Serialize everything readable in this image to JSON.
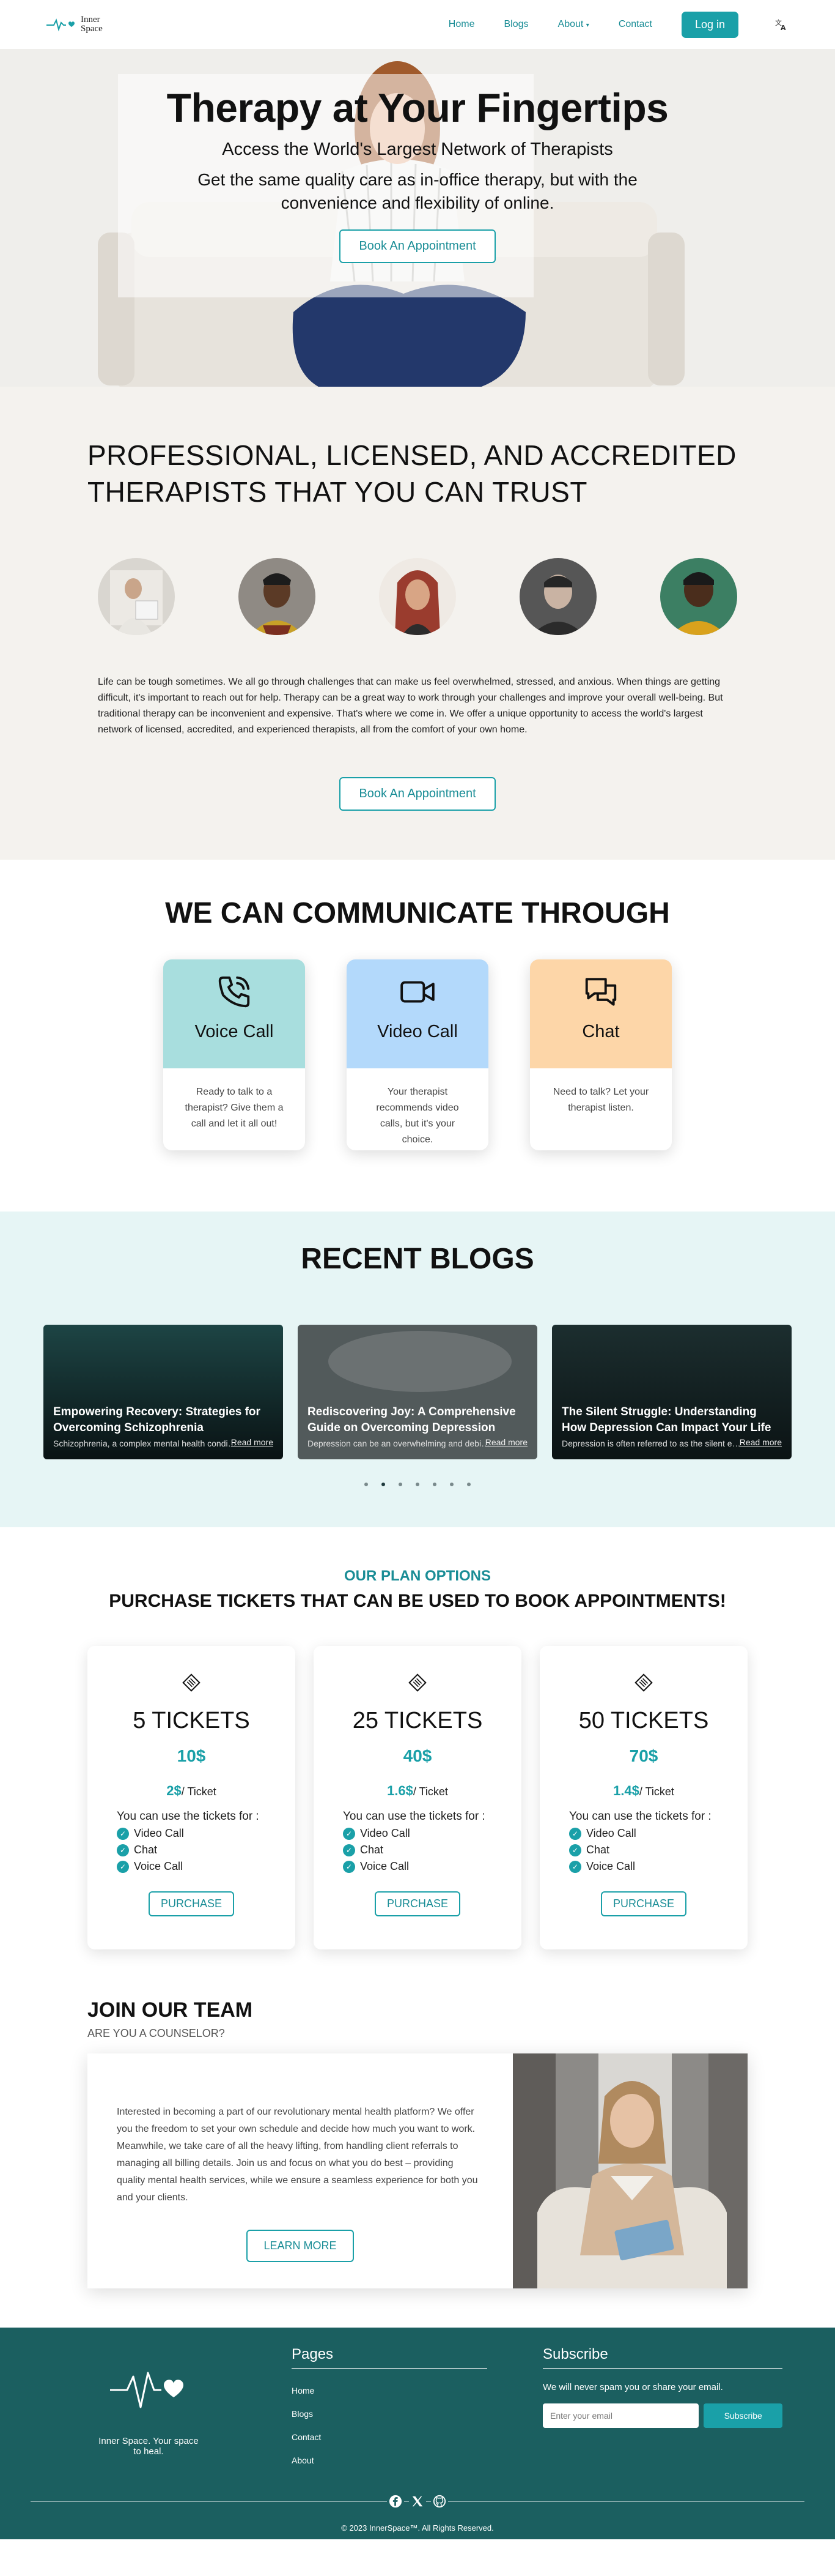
{
  "nav": {
    "brand_line1": "Inner",
    "brand_line2": "Space",
    "links": [
      "Home",
      "Blogs",
      "About",
      "Contact"
    ],
    "login": "Log in"
  },
  "hero": {
    "title": "Therapy at Your Fingertips",
    "subtitle": "Access the World's Largest Network of Therapists",
    "text": "Get the same quality care as in-office therapy, but with the convenience and flexibility of online.",
    "button": "Book An Appointment"
  },
  "therapists": {
    "heading": "PROFESSIONAL, LICENSED, AND ACCREDITED THERAPISTS THAT YOU CAN TRUST",
    "about": "Life can be tough sometimes. We all go through challenges that can make us feel overwhelmed, stressed, and anxious. When things are getting difficult, it's important to reach out for help. Therapy can be a great way to work through your challenges and improve your overall well-being. But traditional therapy can be inconvenient and expensive. That's where we come in. We offer a unique opportunity to access the world's largest network of licensed, accredited, and experienced therapists, all from the comfort of your own home.",
    "button": "Book An Appointment"
  },
  "communicate": {
    "title": "WE CAN COMMUNICATE THROUGH",
    "cards": [
      {
        "label": "Voice Call",
        "desc": "Ready to talk to a therapist? Give them a call and let it all out!",
        "icon": "phone-icon",
        "color": "#a8dede"
      },
      {
        "label": "Video Call",
        "desc": "Your therapist recommends video calls, but it's your choice.",
        "icon": "video-icon",
        "color": "#b3d9fb"
      },
      {
        "label": "Chat",
        "desc": "Need to talk? Let your therapist listen.",
        "icon": "chat-icon",
        "color": "#fdd6a8"
      }
    ]
  },
  "blogs": {
    "title": "RECENT BLOGS",
    "read_more": "Read more",
    "items": [
      {
        "title": "Empowering Recovery: Strategies for Overcoming Schizophrenia",
        "excerpt": "Schizophrenia, a complex mental health condition,..."
      },
      {
        "title": "Rediscovering Joy: A Comprehensive Guide on Overcoming Depression",
        "excerpt": "Depression can be an overwhelming and debilitating..."
      },
      {
        "title": "The Silent Struggle: Understanding How Depression Can Impact Your Life",
        "excerpt": "Depression is often referred to as the silent epidemic..."
      }
    ],
    "active_page": 2,
    "page_count": 7
  },
  "plans": {
    "eyebrow": "OUR PLAN OPTIONS",
    "title": "PURCHASE TICKETS THAT CAN BE USED TO BOOK APPOINTMENTS!",
    "use_label": "You can use the tickets for :",
    "per_unit": "/ Ticket",
    "features": [
      "Video Call",
      "Chat",
      "Voice Call"
    ],
    "button": "PURCHASE",
    "items": [
      {
        "name": "5 TICKETS",
        "price": "10$",
        "per": "2$"
      },
      {
        "name": "25 TICKETS",
        "price": "40$",
        "per": "1.6$"
      },
      {
        "name": "50 TICKETS",
        "price": "70$",
        "per": "1.4$"
      }
    ]
  },
  "team": {
    "title": "JOIN OUR TEAM",
    "subtitle": "ARE YOU A COUNSELOR?",
    "text": "Interested in becoming a part of our revolutionary mental health platform? We offer you the freedom to set your own schedule and decide how much you want to work. Meanwhile, we take care of all the heavy lifting, from handling client referrals to managing all billing details. Join us and focus on what you do best – providing quality mental health services, while we ensure a seamless experience for both you and your clients.",
    "button": "LEARN MORE"
  },
  "footer": {
    "tagline": "Inner Space. Your space to heal.",
    "pages_title": "Pages",
    "pages": [
      "Home",
      "Blogs",
      "Contact",
      "About"
    ],
    "subscribe_title": "Subscribe",
    "subscribe_note": "We will never spam you or share your email.",
    "email_placeholder": "Enter your email",
    "subscribe_button": "Subscribe",
    "copyright": "© 2023 InnerSpace™. All Rights Reserved."
  },
  "colors": {
    "accent": "#1aa0a8",
    "footer_bg": "#1b5f60",
    "cream": "#f4f2ee",
    "light_teal": "#e6f5f5"
  }
}
